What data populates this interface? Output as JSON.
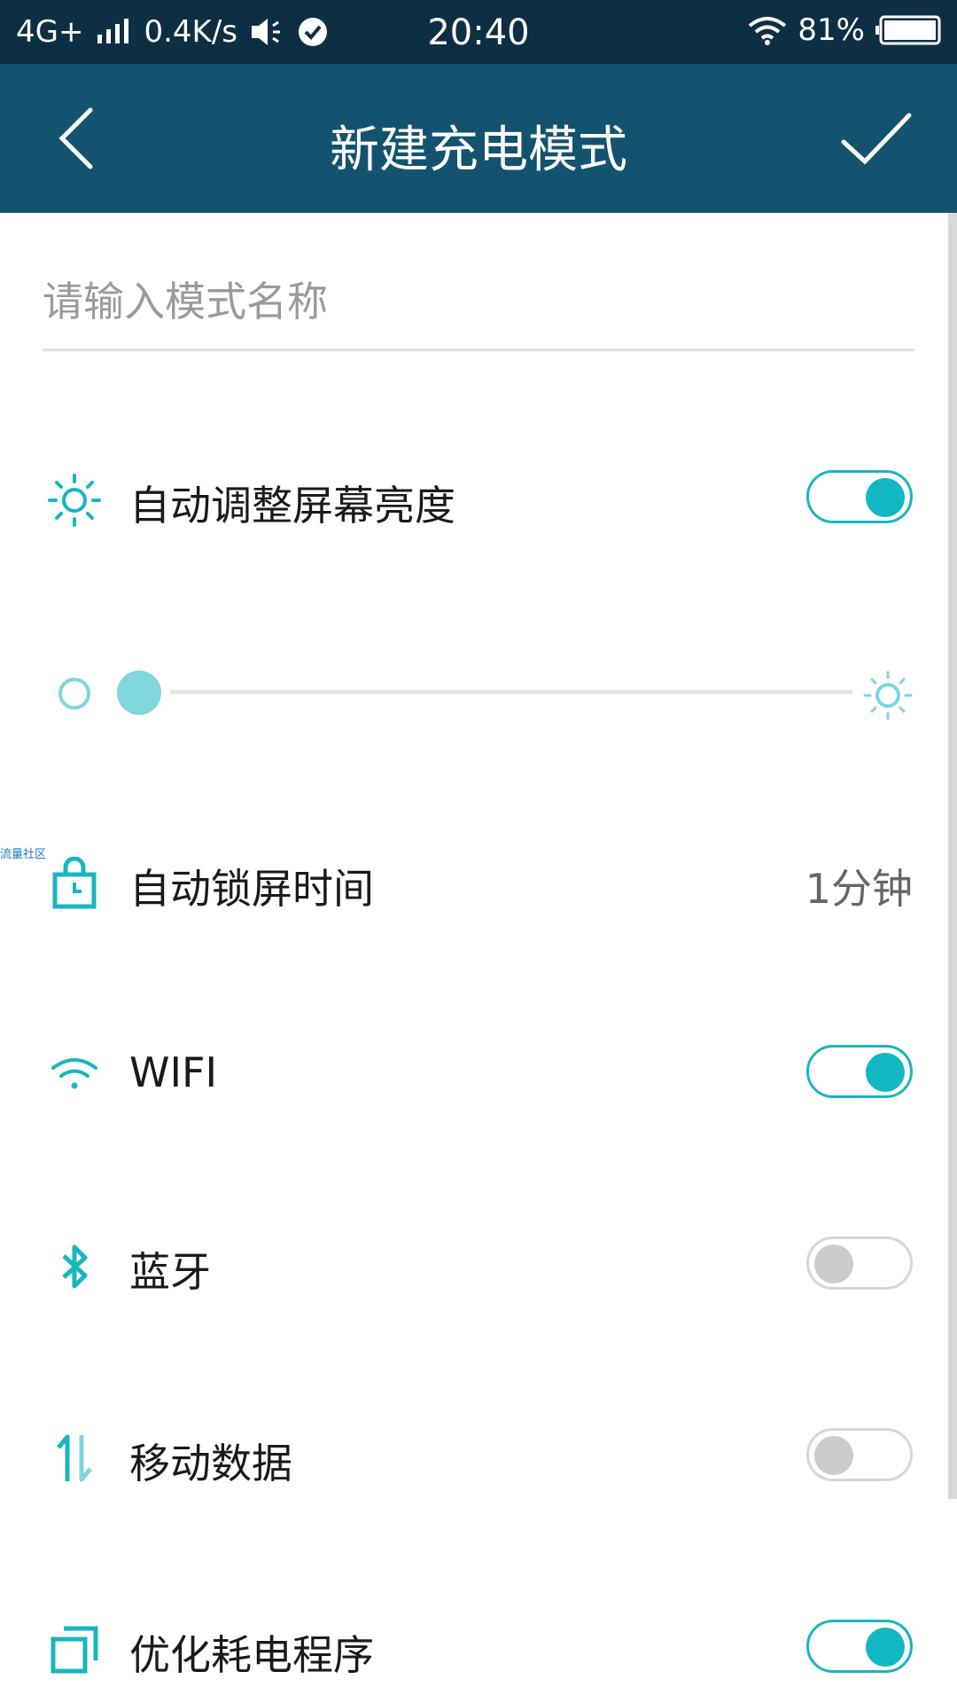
{
  "status_bar": {
    "network": "4G+",
    "speed": "0.4K/s",
    "time": "20:40",
    "battery": "81%",
    "icons": [
      "signal-icon",
      "speaker-icon",
      "check-circle-icon",
      "wifi-icon",
      "battery-icon"
    ]
  },
  "app_bar": {
    "title": "新建充电模式",
    "back_icon": "chevron-left-icon",
    "confirm_icon": "check-icon"
  },
  "name_field": {
    "placeholder": "请输入模式名称",
    "value": ""
  },
  "settings": {
    "auto_brightness": {
      "label": "自动调整屏幕亮度",
      "icon": "sun-icon",
      "enabled": true
    },
    "brightness_slider": {
      "level": 0.0,
      "min_icon": "sun-low-icon",
      "max_icon": "sun-high-icon"
    },
    "auto_lock": {
      "label": "自动锁屏时间",
      "value": "1分钟",
      "icon": "lock-clock-icon"
    },
    "wifi": {
      "label": "WIFI",
      "icon": "wifi-icon",
      "enabled": true
    },
    "bluetooth": {
      "label": "蓝牙",
      "icon": "bluetooth-icon",
      "enabled": false
    },
    "mobile_data": {
      "label": "移动数据",
      "icon": "data-transfer-icon",
      "enabled": false
    },
    "optimize_apps": {
      "label": "优化耗电程序",
      "icon": "layers-icon",
      "enabled": true
    }
  },
  "watermark": "流量社区",
  "colors": {
    "status_bar": "#0d2f44",
    "app_bar": "#14536f",
    "accent": "#12b8c1",
    "accent_light": "#7fd6dc",
    "toggle_off": "#cccccc"
  }
}
